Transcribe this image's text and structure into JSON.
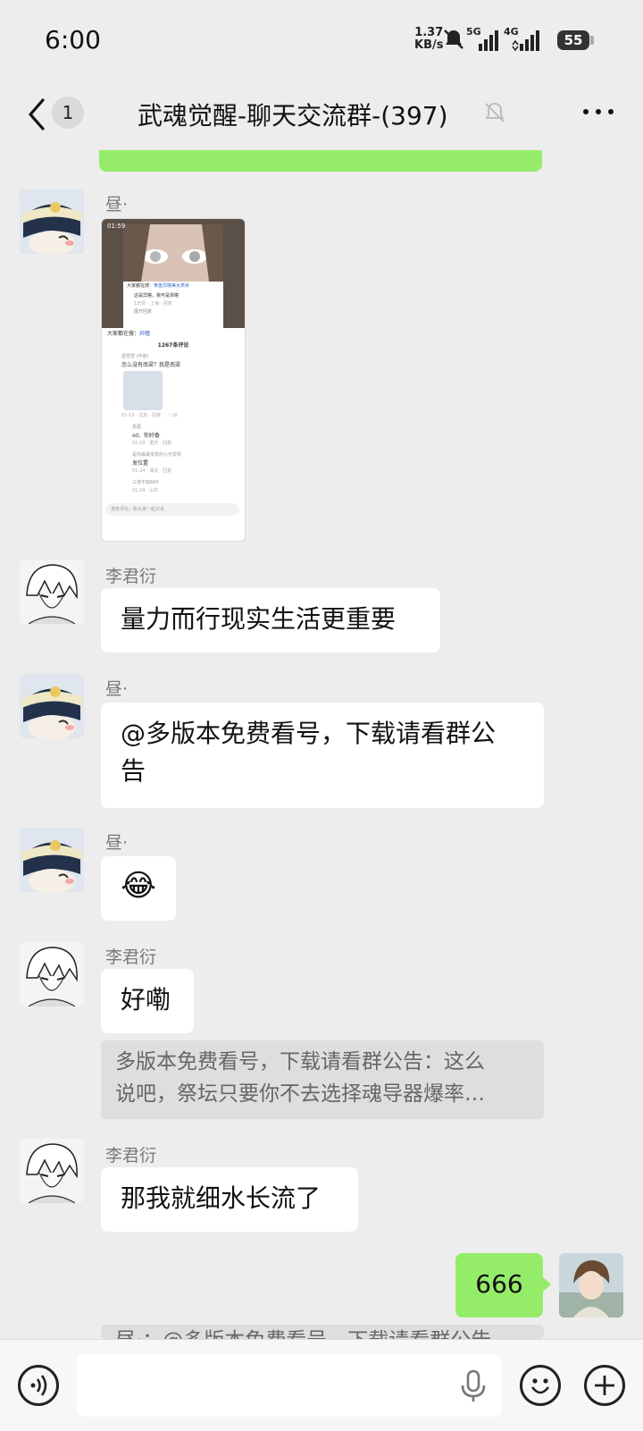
{
  "status_bar": {
    "time": "6:00",
    "net_speed_value": "1.37",
    "net_speed_unit": "KB/s",
    "sig1": "5G",
    "sig2": "4G",
    "battery": "55"
  },
  "header": {
    "unread": "1",
    "title": "武魂觉醒-聊天交流群-(397)"
  },
  "messages": {
    "m1": {
      "sender": "昼·"
    },
    "shot": {
      "time": "01:59",
      "overlay_label": "大家都在搜：",
      "overlay_query": "黄金异瞳美女类目",
      "overlay_reply": "这是异瞳，我可是单瞳",
      "overlay_meta": "1天前 · 上海 · 回复",
      "overlay_expand": "展开回复",
      "search_label": "大家都在搜：",
      "search_query": "异瞳",
      "comment_count": "1267条评论",
      "c1_user": "昼雪雪 (作者)",
      "c1_text": "怎么没有南梁？我是南梁",
      "c1_meta": "01-15 · 北京 · 回复",
      "c1_likes": "16",
      "c2_user": "嘉嘉",
      "c2_text": "sd，你好香",
      "c2_meta": "01-23 · 重庆 · 回复",
      "c3_user": "是你最最亲爱的小可爱呀",
      "c3_text": "发位置",
      "c3_meta": "01-24 · 湖北 · 回复",
      "c4_user": "三连不如666",
      "c4_meta": "01-24 · 山东",
      "input_placeholder": "发条评论，和大家一起讨论"
    },
    "m2": {
      "sender": "李君衍",
      "text": "量力而行现实生活更重要"
    },
    "m3": {
      "sender": "昼·",
      "text_line1": "@多版本免费看号，下载请看群公",
      "text_line2": "告"
    },
    "m4": {
      "sender": "昼·",
      "emoji": "😂"
    },
    "m5": {
      "sender": "李君衍",
      "text": "好嘞",
      "quote_line1": "多版本免费看号，下载请看群公告：这么",
      "quote_line2": "说吧，祭坛只要你不去选择魂导器爆率…"
    },
    "m6": {
      "sender": "李君衍",
      "text": "那我就细水长流了"
    },
    "m7": {
      "text": "666",
      "quote_partial": "昼·：@多版本免费看号，下载请看群公告"
    }
  },
  "icon_names": {
    "back": "chevron-left-icon",
    "mute": "mute-bell-icon",
    "more": "more-dots-icon",
    "voice": "voice-icon",
    "mic": "microphone-icon",
    "emoji": "emoji-icon",
    "plus": "plus-icon"
  }
}
